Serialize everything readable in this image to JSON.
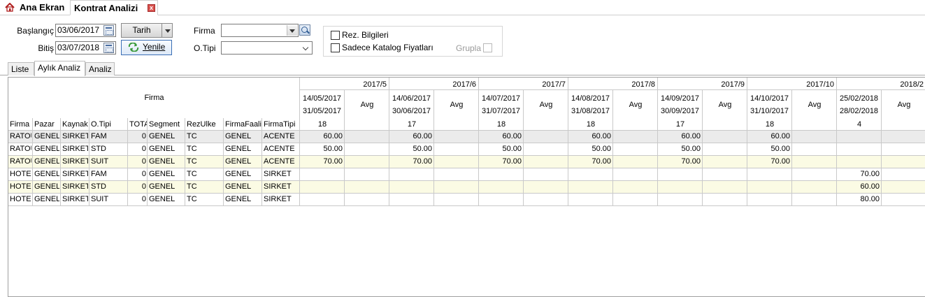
{
  "doc_tabs": {
    "home_label": "Ana Ekran",
    "active_label": "Kontrat Analizi",
    "close_glyph": "x"
  },
  "filters": {
    "start_label": "Başlangıç",
    "start_value": "03/06/2017",
    "end_label": "Bitiş",
    "end_value": "03/07/2018",
    "date_mode_label": "Tarih",
    "refresh_label": "Yenile",
    "firma_label": "Firma",
    "firma_value": "",
    "otipi_label": "O.Tipi",
    "otipi_value": ""
  },
  "options": {
    "rez_label": "Rez. Bilgileri",
    "katalog_label": "Sadece Katalog Fiyatları",
    "grupla_label": "Grupla"
  },
  "sub_tabs": [
    {
      "label": "Liste"
    },
    {
      "label": "Aylık Analiz"
    },
    {
      "label": "Analiz"
    }
  ],
  "grid": {
    "group_header": "Firma",
    "fixed_columns": [
      "Firma",
      "Pazar",
      "Kaynak",
      "O.Tipi",
      "TOTAL",
      "Segment",
      "RezUlke",
      "FirmaFaaliyet",
      "FirmaTipi"
    ],
    "avg_label": "Avg",
    "months": [
      {
        "name": "2017/5",
        "from": "14/05/2017",
        "to": "31/05/2017",
        "count": "18"
      },
      {
        "name": "2017/6",
        "from": "14/06/2017",
        "to": "30/06/2017",
        "count": "17"
      },
      {
        "name": "2017/7",
        "from": "14/07/2017",
        "to": "31/07/2017",
        "count": "18"
      },
      {
        "name": "2017/8",
        "from": "14/08/2017",
        "to": "31/08/2017",
        "count": "18"
      },
      {
        "name": "2017/9",
        "from": "14/09/2017",
        "to": "30/09/2017",
        "count": "17"
      },
      {
        "name": "2017/10",
        "from": "14/10/2017",
        "to": "31/10/2017",
        "count": "18"
      },
      {
        "name": "2018/2",
        "from": "25/02/2018",
        "to": "28/02/2018",
        "count": "4"
      }
    ],
    "rows": [
      {
        "firma": "RATOUR",
        "pazar": "GENEL",
        "kaynak": "SIRKET",
        "otipi": "FAM",
        "total": "0",
        "segment": "GENEL",
        "rezulke": "TC",
        "faaliyet": "GENEL",
        "tipi": "ACENTE",
        "values": [
          "60.00",
          "60.00",
          "60.00",
          "60.00",
          "60.00",
          "60.00",
          ""
        ],
        "style": "gray"
      },
      {
        "firma": "RATOUR",
        "pazar": "GENEL",
        "kaynak": "SIRKET",
        "otipi": "STD",
        "total": "0",
        "segment": "GENEL",
        "rezulke": "TC",
        "faaliyet": "GENEL",
        "tipi": "ACENTE",
        "values": [
          "50.00",
          "50.00",
          "50.00",
          "50.00",
          "50.00",
          "50.00",
          ""
        ],
        "style": "white"
      },
      {
        "firma": "RATOUR",
        "pazar": "GENEL",
        "kaynak": "SIRKET",
        "otipi": "SUIT",
        "total": "0",
        "segment": "GENEL",
        "rezulke": "TC",
        "faaliyet": "GENEL",
        "tipi": "ACENTE",
        "values": [
          "70.00",
          "70.00",
          "70.00",
          "70.00",
          "70.00",
          "70.00",
          ""
        ],
        "style": "yellow"
      },
      {
        "firma": "HOTEC",
        "pazar": "GENEL",
        "kaynak": "SIRKET",
        "otipi": "FAM",
        "total": "0",
        "segment": "GENEL",
        "rezulke": "TC",
        "faaliyet": "GENEL",
        "tipi": "SIRKET",
        "values": [
          "",
          "",
          "",
          "",
          "",
          "",
          "70.00"
        ],
        "style": "white"
      },
      {
        "firma": "HOTEC",
        "pazar": "GENEL",
        "kaynak": "SIRKET",
        "otipi": "STD",
        "total": "0",
        "segment": "GENEL",
        "rezulke": "TC",
        "faaliyet": "GENEL",
        "tipi": "SIRKET",
        "values": [
          "",
          "",
          "",
          "",
          "",
          "",
          "60.00"
        ],
        "style": "yellow"
      },
      {
        "firma": "HOTEC",
        "pazar": "GENEL",
        "kaynak": "SIRKET",
        "otipi": "SUIT",
        "total": "0",
        "segment": "GENEL",
        "rezulke": "TC",
        "faaliyet": "GENEL",
        "tipi": "SIRKET",
        "values": [
          "",
          "",
          "",
          "",
          "",
          "",
          "80.00"
        ],
        "style": "white"
      }
    ]
  },
  "colors": {
    "row_gray": "#ebebeb",
    "row_yellow": "#fbfbe4",
    "row_white": "#ffffff",
    "grid_line": "#c9c9c9",
    "close_red": "#d9534f"
  }
}
